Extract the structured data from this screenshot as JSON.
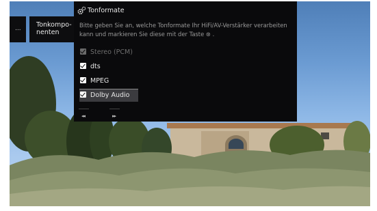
{
  "sidebar": {
    "collapsed_label": "...",
    "item_label": "Tonkompo-\nnenten"
  },
  "dialog": {
    "title": "Tonformate",
    "description": "Bitte geben Sie an, welche Tonformate Ihr HiFi/AV-Verstärker verarbeiten kann und markieren Sie diese mit der Taste ⊛ .",
    "options": [
      {
        "label": "Stereo (PCM)",
        "checked": true,
        "disabled": true
      },
      {
        "label": "dts",
        "checked": true,
        "disabled": false
      },
      {
        "label": "MPEG",
        "checked": true,
        "disabled": false
      },
      {
        "label": "Dolby Audio",
        "checked": true,
        "disabled": false,
        "focused": true
      }
    ],
    "nav": {
      "prev_symbol": "◂◂",
      "next_symbol": "▸▸"
    },
    "icon": "gear-icon"
  },
  "colors": {
    "dialog_bg": "#0a0a0c",
    "focus_bg": "#3b3b3f",
    "sky": "#8db7e6"
  }
}
